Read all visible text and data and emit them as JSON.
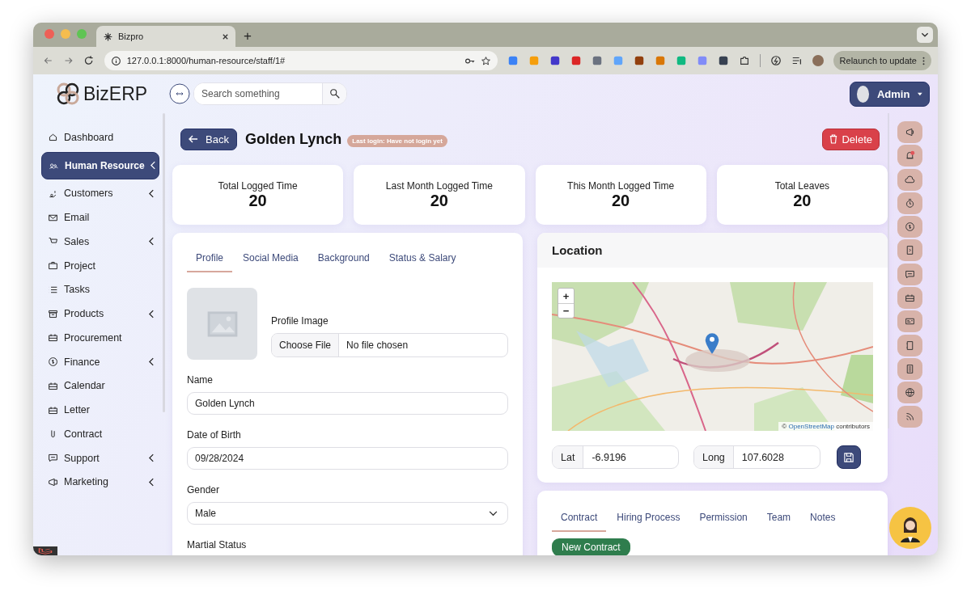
{
  "browser": {
    "tab_title": "Bizpro",
    "new_tab": "+",
    "url": "127.0.0.1:8000/human-resource/staff/1#",
    "relaunch": "Relaunch to update"
  },
  "topbar": {
    "logo": "BizERP",
    "search_placeholder": "Search something",
    "user": "Admin"
  },
  "sidebar": [
    {
      "label": "Dashboard",
      "expandable": false,
      "selected": false
    },
    {
      "label": "Human Resource",
      "expandable": true,
      "selected": true
    },
    {
      "label": "Customers",
      "expandable": true,
      "selected": false
    },
    {
      "label": "Email",
      "expandable": false,
      "selected": false
    },
    {
      "label": "Sales",
      "expandable": true,
      "selected": false
    },
    {
      "label": "Project",
      "expandable": false,
      "selected": false
    },
    {
      "label": "Tasks",
      "expandable": false,
      "selected": false
    },
    {
      "label": "Products",
      "expandable": true,
      "selected": false
    },
    {
      "label": "Procurement",
      "expandable": false,
      "selected": false
    },
    {
      "label": "Finance",
      "expandable": true,
      "selected": false
    },
    {
      "label": "Calendar",
      "expandable": false,
      "selected": false
    },
    {
      "label": "Letter",
      "expandable": false,
      "selected": false
    },
    {
      "label": "Contract",
      "expandable": false,
      "selected": false
    },
    {
      "label": "Support",
      "expandable": true,
      "selected": false
    },
    {
      "label": "Marketing",
      "expandable": true,
      "selected": false
    }
  ],
  "header": {
    "back": "Back",
    "title": "Golden Lynch",
    "badge": "Last login: Have not login yet",
    "delete": "Delete"
  },
  "stats": [
    {
      "label": "Total Logged Time",
      "value": "20"
    },
    {
      "label": "Last Month Logged Time",
      "value": "20"
    },
    {
      "label": "This Month Logged Time",
      "value": "20"
    },
    {
      "label": "Total Leaves",
      "value": "20"
    }
  ],
  "profile": {
    "tabs": [
      {
        "label": "Profile",
        "selected": true
      },
      {
        "label": "Social Media",
        "selected": false
      },
      {
        "label": "Background",
        "selected": false
      },
      {
        "label": "Status & Salary",
        "selected": false
      }
    ],
    "image_label": "Profile Image",
    "file_button": "Choose File",
    "file_status": "No file chosen",
    "fields": [
      {
        "kind": "text",
        "label": "Name",
        "value": "Golden Lynch"
      },
      {
        "kind": "text",
        "label": "Date of Birth",
        "value": "09/28/2024"
      },
      {
        "kind": "select",
        "label": "Gender",
        "value": "Male"
      }
    ],
    "next_label": "Martial Status"
  },
  "location": {
    "title": "Location",
    "zoom_in": "+",
    "zoom_out": "−",
    "attribution": "©",
    "attribution_link": "OpenStreetMap",
    "attribution_tail": "contributors",
    "lat_label": "Lat",
    "lat": "-6.9196",
    "long_label": "Long",
    "long": "107.6028"
  },
  "details": {
    "tabs": [
      {
        "label": "Contract",
        "selected": true
      },
      {
        "label": "Hiring Process",
        "selected": false
      },
      {
        "label": "Permission",
        "selected": false
      },
      {
        "label": "Team",
        "selected": false
      },
      {
        "label": "Notes",
        "selected": false
      }
    ],
    "new_button": "New Contract"
  }
}
